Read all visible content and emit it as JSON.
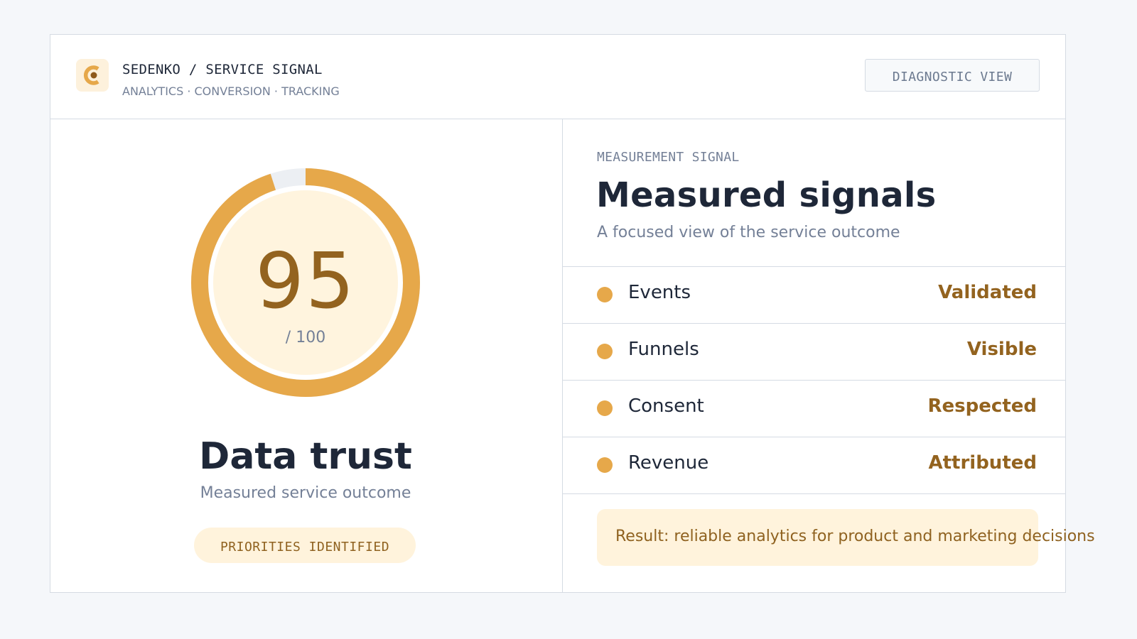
{
  "header": {
    "brand": "SEDENKO / SERVICE SIGNAL",
    "tags": "ANALYTICS · CONVERSION · TRACKING",
    "view_button": "DIAGNOSTIC VIEW",
    "logo_icon": "brand-c-icon"
  },
  "score": {
    "value": "95",
    "max": "/ 100",
    "percent": 95,
    "title": "Data trust",
    "subtitle": "Measured service outcome",
    "badge": "PRIORITIES IDENTIFIED"
  },
  "signals": {
    "eyebrow": "MEASUREMENT SIGNAL",
    "title": "Measured signals",
    "subtitle": "A focused view of the service outcome",
    "items": [
      {
        "label": "Events",
        "value": "Validated"
      },
      {
        "label": "Funnels",
        "value": "Visible"
      },
      {
        "label": "Consent",
        "value": "Respected"
      },
      {
        "label": "Revenue",
        "value": "Attributed"
      }
    ],
    "result": "Result: reliable analytics for product and marketing decisions"
  },
  "colors": {
    "accent": "#e6a84a",
    "accent_dark": "#93631f",
    "accent_soft": "#fff3dc",
    "track": "#eceff3",
    "ink": "#1e2738",
    "muted": "#748097"
  }
}
